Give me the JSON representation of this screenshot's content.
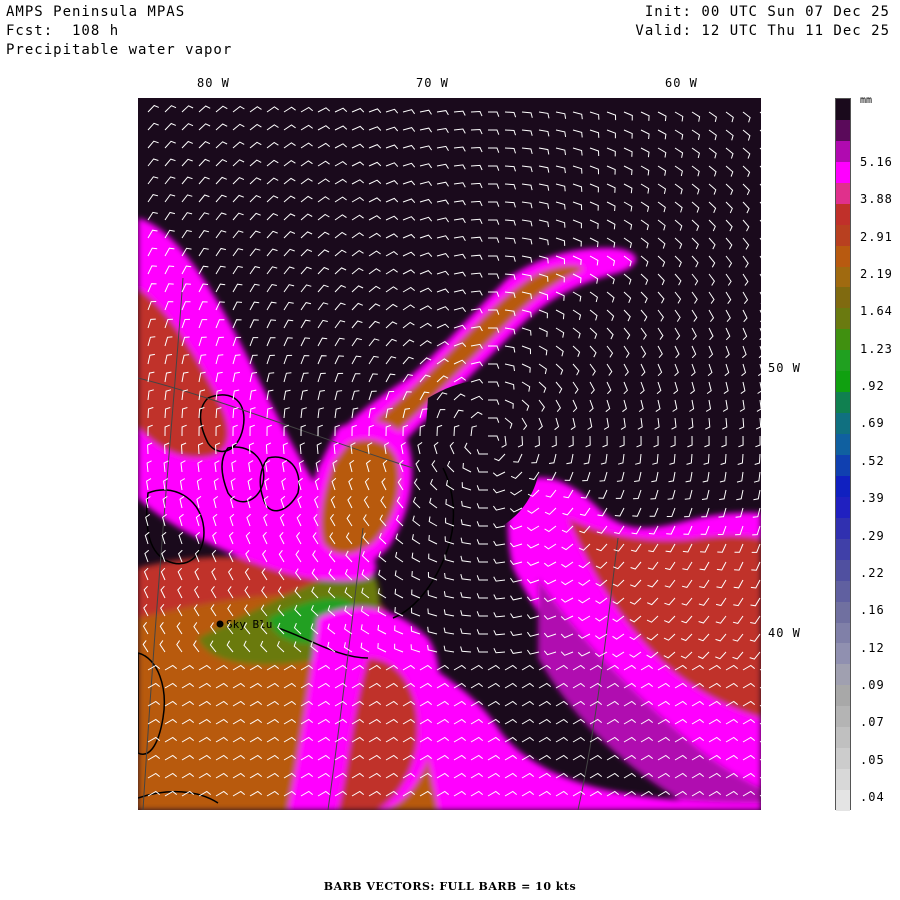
{
  "header": {
    "model": "AMPS Peninsula MPAS",
    "forecast": "Fcst:  108 h",
    "field": "Precipitable water vapor",
    "init": "Init: 00 UTC Sun 07 Dec 25",
    "valid": "Valid: 12 UTC Thu 11 Dec 25"
  },
  "map": {
    "lon_labels": [
      "80 W",
      "70 W",
      "60 W"
    ],
    "lat_labels": [
      "50 W",
      "40 W"
    ],
    "station_label": "Sky Blu",
    "barb_color": "#ffffff"
  },
  "colorbar": {
    "unit": "mm",
    "tick_labels": [
      "5.16",
      "3.88",
      "2.91",
      "2.19",
      "1.64",
      "1.23",
      ".92",
      ".69",
      ".52",
      ".39",
      ".29",
      ".22",
      ".16",
      ".12",
      ".09",
      ".07",
      ".05",
      ".04"
    ],
    "colors": [
      "#1a0a1c",
      "#5a0a5a",
      "#b00ab0",
      "#ff00ff",
      "#e0308c",
      "#c0302a",
      "#b84020",
      "#b85a10",
      "#a06a10",
      "#806a10",
      "#6a7a10",
      "#409010",
      "#20a020",
      "#10a010",
      "#108050",
      "#107080",
      "#1060a0",
      "#1040b0",
      "#1020c0",
      "#2020c0",
      "#3030b0",
      "#4040a8",
      "#5050a0",
      "#6060a0",
      "#7070a0",
      "#8080a8",
      "#9090b0",
      "#a0a0b0",
      "#a8a8a8",
      "#b4b4b4",
      "#c0c0c0",
      "#cccccc",
      "#d8d8d8",
      "#e4e4e4"
    ]
  },
  "footer": {
    "text": "BARB VECTORS:  FULL BARB = 10 kts"
  }
}
